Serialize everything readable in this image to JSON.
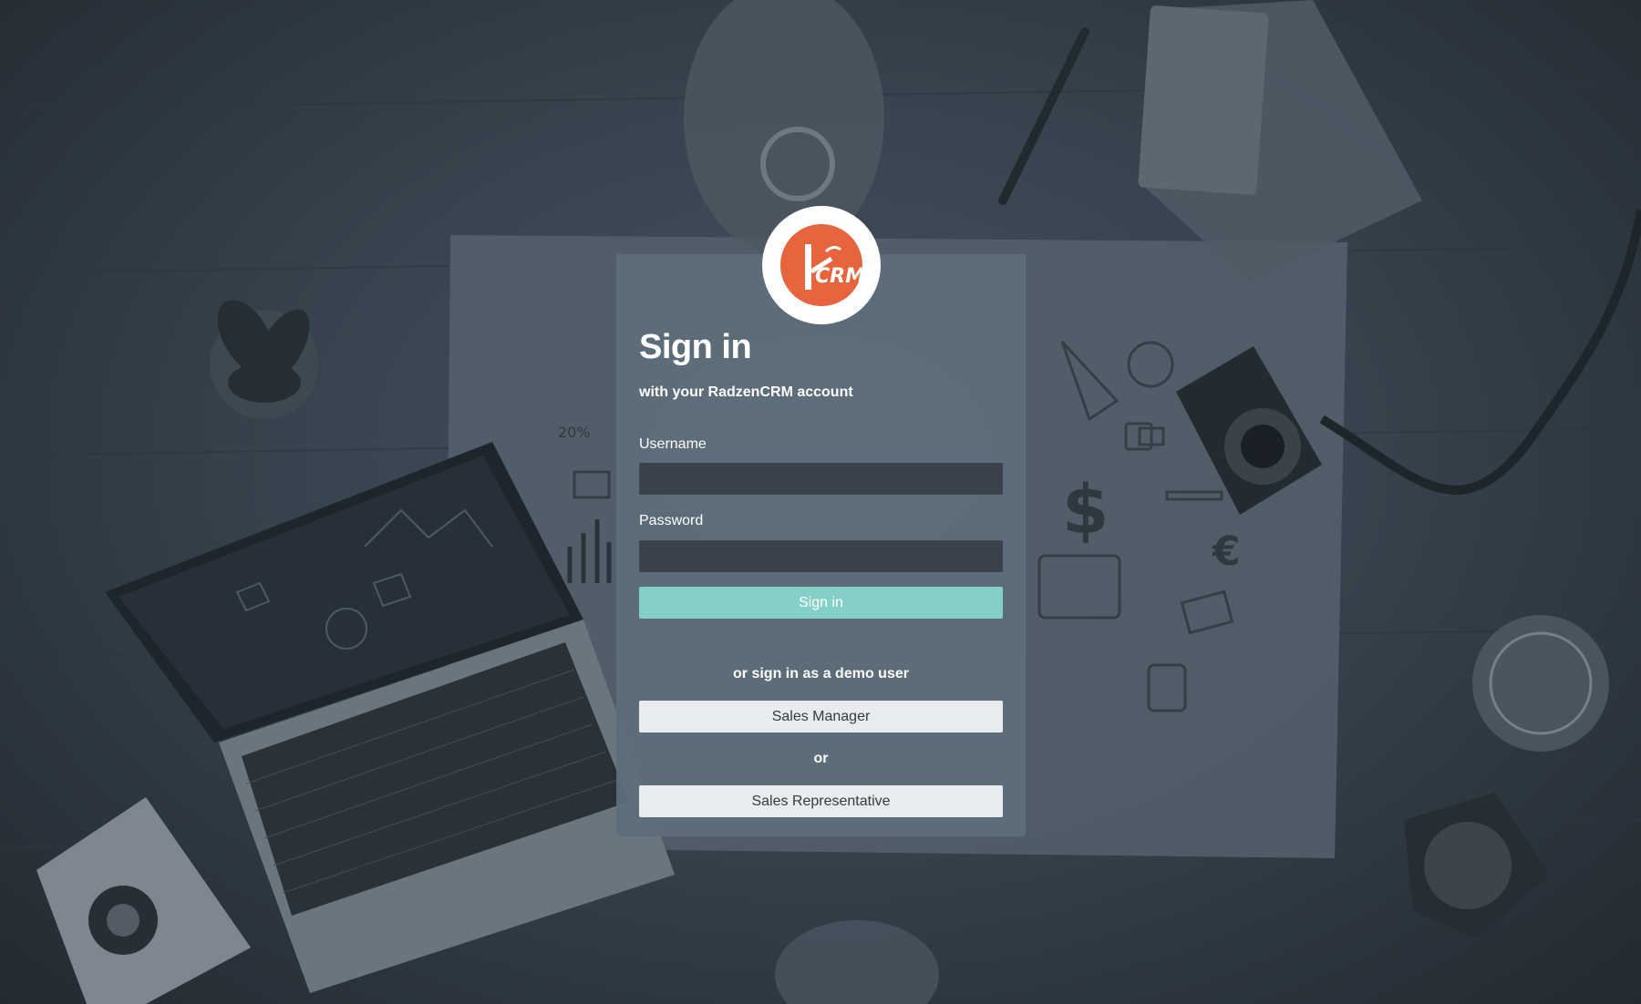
{
  "brand": {
    "logo_text": "CRM",
    "logo_color": "#e8643c"
  },
  "login": {
    "title": "Sign in",
    "subtitle": "with your RadzenCRM account",
    "username_label": "Username",
    "username_value": "",
    "password_label": "Password",
    "password_value": "",
    "signin_label": "Sign in",
    "signin_color": "#84d0c6"
  },
  "demo": {
    "heading": "or sign in as a demo user",
    "sales_manager_label": "Sales Manager",
    "or_text": "or",
    "sales_rep_label": "Sales Representative"
  },
  "background_icons": {
    "label_percent": "20%",
    "currency_dollar": "$",
    "currency_euro": "€"
  }
}
